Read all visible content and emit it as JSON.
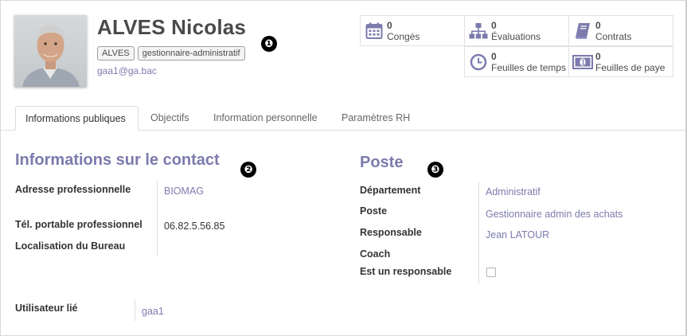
{
  "employee": {
    "name": "ALVES Nicolas",
    "tags": [
      "ALVES",
      "gestionnaire-administratif"
    ],
    "email": "gaa1@ga.bac"
  },
  "markers": [
    "❶",
    "❷",
    "❸"
  ],
  "stats": [
    {
      "count": "0",
      "label": "Congés",
      "icon": "calendar-icon"
    },
    {
      "count": "0",
      "label": "Évaluations",
      "icon": "org-chart-icon"
    },
    {
      "count": "0",
      "label": "Contrats",
      "icon": "book-icon"
    },
    {
      "count": "0",
      "label": "Feuilles de temps",
      "icon": "clock-icon"
    },
    {
      "count": "0",
      "label": "Feuilles de paye",
      "icon": "money-icon"
    }
  ],
  "tabs": [
    "Informations publiques",
    "Objectifs",
    "Information personnelle",
    "Paramètres RH"
  ],
  "contact": {
    "title": "Informations sur le contact",
    "work_address_label": "Adresse professionnelle",
    "work_address": "BIOMAG",
    "mobile_label": "Tél. portable professionnel",
    "mobile": "06.82.5.56.85",
    "office_label": "Localisation du Bureau",
    "office": ""
  },
  "position": {
    "title": "Poste",
    "department_label": "Département",
    "department": "Administratif",
    "job_label": "Poste",
    "job": "Gestionnaire admin des achats",
    "manager_label": "Responsable",
    "manager": "Jean LATOUR",
    "coach_label": "Coach",
    "coach": "",
    "is_manager_label": "Est un responsable"
  },
  "related_user": {
    "label": "Utilisateur lié",
    "value": "gaa1"
  },
  "colors": {
    "accent": "#7c7bad",
    "text": "#4c4c4c",
    "border": "#dcdcdc"
  }
}
